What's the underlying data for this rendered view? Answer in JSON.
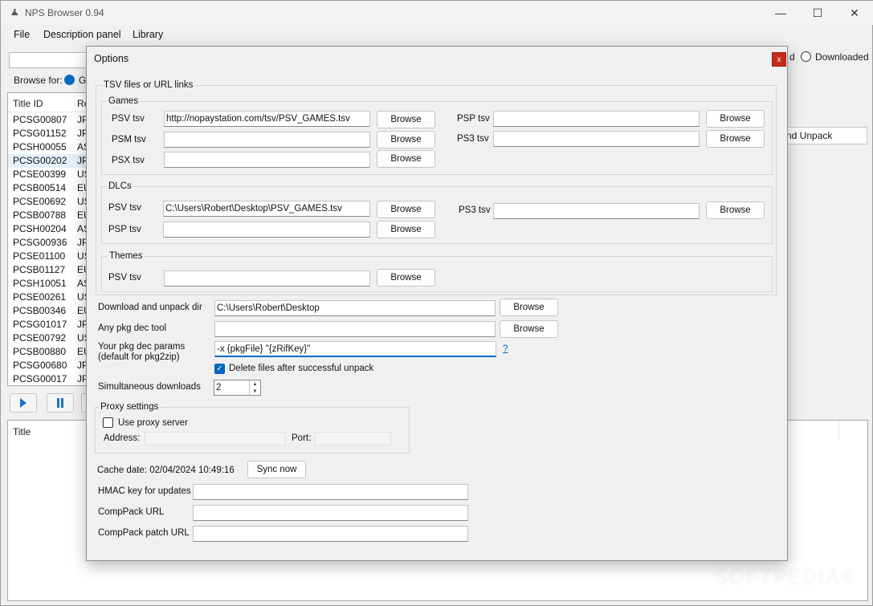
{
  "window": {
    "title": "NPS Browser 0.94",
    "controls": {
      "minimize": "—",
      "maximize": "☐",
      "close": "✕"
    }
  },
  "menu": [
    "File",
    "Description panel",
    "Library"
  ],
  "main": {
    "browse_for_label": "Browse for:",
    "browse_for_selected": "Ga",
    "downloaded_partial": "d",
    "downloaded_label": "Downloaded",
    "list_columns": [
      "Title ID",
      "Re"
    ],
    "list_rows": [
      [
        "PCSG00807",
        "JP"
      ],
      [
        "PCSG01152",
        "JP"
      ],
      [
        "PCSH00055",
        "AS"
      ],
      [
        "PCSG00202",
        "JP"
      ],
      [
        "PCSE00399",
        "US"
      ],
      [
        "PCSB00514",
        "EU"
      ],
      [
        "PCSE00692",
        "US"
      ],
      [
        "PCSB00788",
        "EU"
      ],
      [
        "PCSH00204",
        "AS"
      ],
      [
        "PCSG00936",
        "JP"
      ],
      [
        "PCSE01100",
        "US"
      ],
      [
        "PCSB01127",
        "EU"
      ],
      [
        "PCSH10051",
        "AS"
      ],
      [
        "PCSE00261",
        "US"
      ],
      [
        "PCSB00346",
        "EU"
      ],
      [
        "PCSG01017",
        "JP"
      ],
      [
        "PCSE00792",
        "US"
      ],
      [
        "PCSB00880",
        "EU"
      ],
      [
        "PCSG00680",
        "JP"
      ],
      [
        "PCSG00017",
        "JP"
      ]
    ],
    "selected_row": 3,
    "unpack_button": "nd Unpack",
    "detail_title": "Title"
  },
  "dialog": {
    "title": "Options",
    "close": "x",
    "tsv_group": "TSV files or URL links",
    "games_group": "Games",
    "dlcs_group": "DLCs",
    "themes_group": "Themes",
    "browse": "Browse",
    "games": {
      "psv_label": "PSV tsv",
      "psv_value": "http://nopaystation.com/tsv/PSV_GAMES.tsv",
      "psm_label": "PSM tsv",
      "psm_value": "",
      "psx_label": "PSX tsv",
      "psx_value": "",
      "psp_label": "PSP tsv",
      "psp_value": "",
      "ps3_label": "PS3 tsv",
      "ps3_value": ""
    },
    "dlcs": {
      "psv_label": "PSV tsv",
      "psv_value": "C:\\Users\\Robert\\Desktop\\PSV_GAMES.tsv",
      "psp_label": "PSP tsv",
      "psp_value": "",
      "ps3_label": "PS3 tsv",
      "ps3_value": ""
    },
    "themes": {
      "psv_label": "PSV tsv",
      "psv_value": ""
    },
    "download_dir_label": "Download and unpack dir",
    "download_dir_value": "C:\\Users\\Robert\\Desktop",
    "pkg_dec_label": "Any pkg dec tool",
    "pkg_dec_value": "",
    "pkg_params_label_1": "Your pkg dec params",
    "pkg_params_label_2": "(default for pkg2zip)",
    "pkg_params_value": "-x {pkgFile} \"{zRifKey}\"",
    "pkg_params_help": "?",
    "delete_files_label": "Delete files after successful unpack",
    "delete_files_checked": true,
    "simultaneous_label": "Simultaneous downloads",
    "simultaneous_value": "2",
    "proxy_group": "Proxy settings",
    "use_proxy_label": "Use proxy server",
    "use_proxy_checked": false,
    "address_label": "Address:",
    "port_label": "Port:",
    "cache_date_label": "Cache date: 02/04/2024 10:49:16",
    "sync_now": "Sync now",
    "hmac_label": "HMAC key for updates",
    "comppack_label": "CompPack URL",
    "comppack_patch_label": "CompPack patch URL"
  },
  "watermark": "SOFTPEDIA®"
}
